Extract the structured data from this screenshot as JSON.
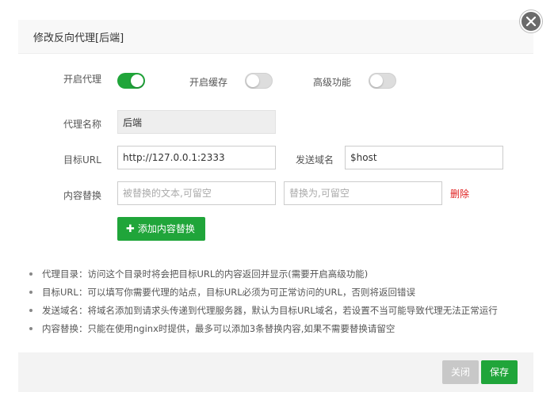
{
  "dialog": {
    "title": "修改反向代理[后端]",
    "close_icon": "close-icon"
  },
  "form": {
    "enable_proxy": {
      "label": "开启代理",
      "enabled": true
    },
    "enable_cache": {
      "label": "开启缓存",
      "enabled": false
    },
    "advanced": {
      "label": "高级功能",
      "enabled": false
    },
    "proxy_name": {
      "label": "代理名称",
      "value": "后端"
    },
    "target_url": {
      "label": "目标URL",
      "value": "http://127.0.0.1:2333"
    },
    "send_domain": {
      "label": "发送域名",
      "value": "$host"
    },
    "content_replace": {
      "label": "内容替换",
      "from_placeholder": "被替换的文本,可留空",
      "to_placeholder": "替换为,可留空",
      "delete_label": "删除"
    },
    "add_replace_label": "添加内容替换"
  },
  "tips": [
    "代理目录：访问这个目录时将会把目标URL的内容返回并显示(需要开启高级功能)",
    "目标URL：可以填写你需要代理的站点，目标URL必须为可正常访问的URL，否则将返回错误",
    "发送域名：将域名添加到请求头传递到代理服务器，默认为目标URL域名，若设置不当可能导致代理无法正常运行",
    "内容替换：只能在使用nginx时提供，最多可以添加3条替换内容,如果不需要替换请留空"
  ],
  "footer": {
    "close_label": "关闭",
    "save_label": "保存"
  },
  "colors": {
    "accent": "#20a53a",
    "danger": "#e02020",
    "disabled": "#c8c8c8"
  }
}
